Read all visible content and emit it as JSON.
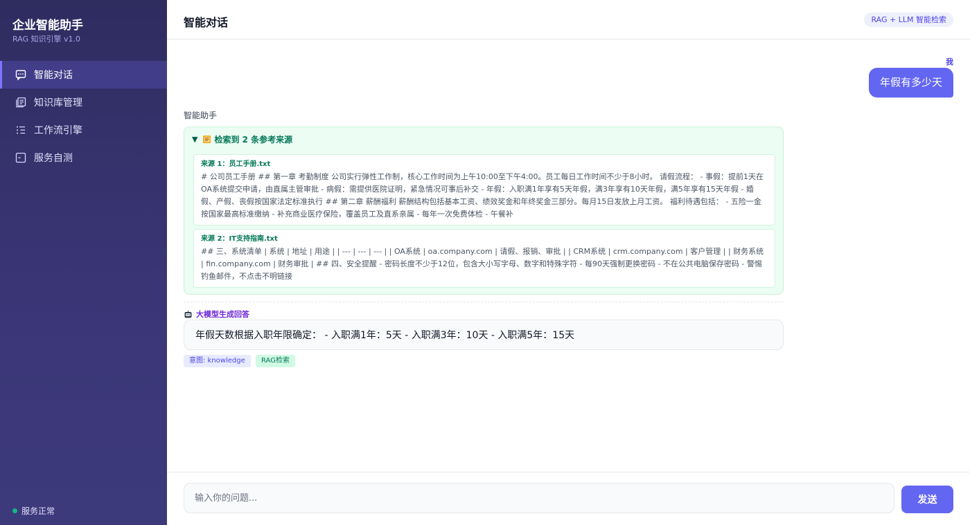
{
  "sidebar": {
    "title": "企业智能助手",
    "subtitle": "RAG 知识引擎 v1.0",
    "items": [
      {
        "label": "智能对话",
        "icon": "chat-icon",
        "active": true
      },
      {
        "label": "知识库管理",
        "icon": "library-icon",
        "active": false
      },
      {
        "label": "工作流引擎",
        "icon": "workflow-list-icon",
        "active": false
      },
      {
        "label": "服务自测",
        "icon": "self-test-icon",
        "active": false
      }
    ],
    "status": {
      "label": "服务正常",
      "color": "#10b981"
    }
  },
  "header": {
    "title": "智能对话",
    "badge": "RAG + LLM 智能检索"
  },
  "chat": {
    "user_label": "我",
    "user_message": "年假有多少天",
    "assistant_label": "智能助手",
    "sources": {
      "icon": "book-icon",
      "header": "检索到 2 条参考来源",
      "items": [
        {
          "title": "来源 1：员工手册.txt",
          "text": "# 公司员工手册 ## 第一章 考勤制度 公司实行弹性工作制，核心工作时间为上午10:00至下午4:00。员工每日工作时间不少于8小时。 请假流程： - 事假：提前1天在OA系统提交申请，由直属主管审批 - 病假：需提供医院证明，紧急情况可事后补交 - 年假：入职满1年享有5天年假，满3年享有10天年假，满5年享有15天年假 - 婚假、产假、丧假按国家法定标准执行 ## 第二章 薪酬福利 薪酬结构包括基本工资、绩效奖金和年终奖金三部分。每月15日发放上月工资。 福利待遇包括： - 五险一金按国家最高标准缴纳 - 补充商业医疗保险，覆盖员工及直系亲属 - 每年一次免费体检 - 午餐补"
        },
        {
          "title": "来源 2：IT支持指南.txt",
          "text": "## 三、系统清单 | 系统 | 地址 | 用途 | | --- | --- | --- | | OA系统 | oa.company.com | 请假、报销、审批 | | CRM系统 | crm.company.com | 客户管理 | | 财务系统 | fin.company.com | 财务审批 | ## 四、安全提醒 - 密码长度不少于12位，包含大小写字母、数字和特殊字符 - 每90天强制更换密码 - 不在公共电脑保存密码 - 警惕钓鱼邮件，不点击不明链接"
        }
      ]
    },
    "generated_label": "大模型生成回答",
    "generated_icon": "robot-icon",
    "answer": "年假天数根据入职年限确定： - 入职满1年：5天 - 入职满3年：10天 - 入职满5年：15天",
    "tags": {
      "intent": "意图: knowledge",
      "mode": "RAG检索"
    }
  },
  "input": {
    "placeholder": "输入你的问题...",
    "value": "",
    "send_label": "发送"
  },
  "colors": {
    "accent": "#6366f1",
    "sidebar_bg": "#2f2c60",
    "source_bg": "#ecfdf4",
    "source_text": "#047857",
    "generated_label": "#6d28d9",
    "status_ok": "#10b981"
  }
}
